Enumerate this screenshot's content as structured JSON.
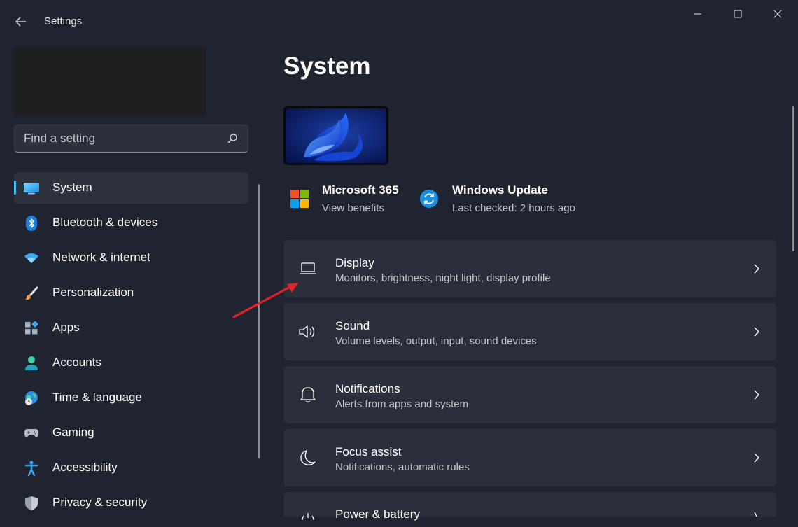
{
  "window": {
    "title": "Settings",
    "back_icon": "back-arrow-icon",
    "minimize_icon": "minimize-icon",
    "maximize_icon": "maximize-icon",
    "close_icon": "close-icon"
  },
  "search": {
    "placeholder": "Find a setting",
    "value": "",
    "icon": "search-icon"
  },
  "sidebar": {
    "selected": "System",
    "accent_color": "#4cc2ff",
    "items": [
      {
        "label": "System",
        "icon": "system-monitor-icon"
      },
      {
        "label": "Bluetooth & devices",
        "icon": "bluetooth-icon"
      },
      {
        "label": "Network & internet",
        "icon": "wifi-icon"
      },
      {
        "label": "Personalization",
        "icon": "paintbrush-icon"
      },
      {
        "label": "Apps",
        "icon": "apps-icon"
      },
      {
        "label": "Accounts",
        "icon": "account-icon"
      },
      {
        "label": "Time & language",
        "icon": "globe-clock-icon"
      },
      {
        "label": "Gaming",
        "icon": "gamepad-icon"
      },
      {
        "label": "Accessibility",
        "icon": "accessibility-icon"
      },
      {
        "label": "Privacy & security",
        "icon": "shield-icon"
      }
    ]
  },
  "main": {
    "title": "System",
    "device_image_icon": "windows-bloom-wallpaper-icon",
    "tiles": [
      {
        "title": "Microsoft 365",
        "subtitle": "View benefits",
        "icon": "microsoft-logo-icon"
      },
      {
        "title": "Windows Update",
        "subtitle": "Last checked: 2 hours ago",
        "icon": "windows-update-icon"
      }
    ],
    "cards": [
      {
        "title": "Display",
        "subtitle": "Monitors, brightness, night light, display profile",
        "icon": "laptop-icon"
      },
      {
        "title": "Sound",
        "subtitle": "Volume levels, output, input, sound devices",
        "icon": "speaker-icon"
      },
      {
        "title": "Notifications",
        "subtitle": "Alerts from apps and system",
        "icon": "bell-icon"
      },
      {
        "title": "Focus assist",
        "subtitle": "Notifications, automatic rules",
        "icon": "moon-icon"
      },
      {
        "title": "Power & battery",
        "subtitle": "",
        "icon": "power-icon"
      }
    ],
    "annotation_color": "#e8202a"
  }
}
